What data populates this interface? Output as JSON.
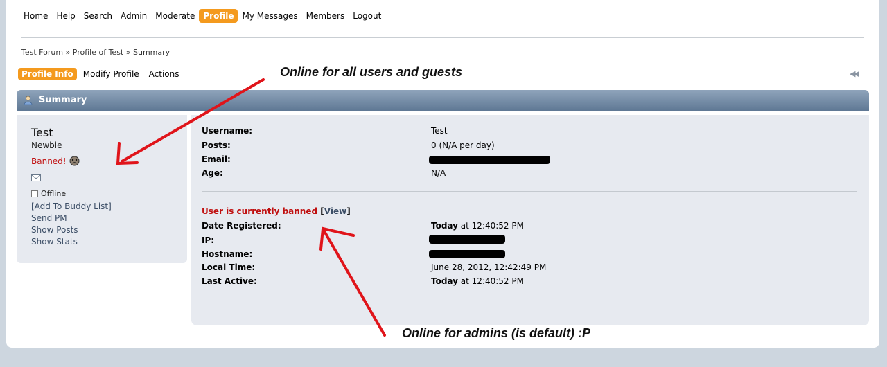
{
  "menu": {
    "items": [
      "Home",
      "Help",
      "Search",
      "Admin",
      "Moderate",
      "Profile",
      "My Messages",
      "Members",
      "Logout"
    ],
    "active": "Profile"
  },
  "breadcrumb": {
    "parts": [
      "Test Forum",
      "Profile of Test",
      "Summary"
    ],
    "separator": "»"
  },
  "subtabs": {
    "items": [
      "Profile Info",
      "Modify Profile",
      "Actions"
    ],
    "active": "Profile Info"
  },
  "summary": {
    "title": "Summary"
  },
  "user": {
    "name": "Test",
    "rank": "Newbie",
    "banned": "Banned!",
    "status": "Offline",
    "links": [
      "[Add To Buddy List]",
      "Send PM",
      "Show Posts",
      "Show Stats"
    ]
  },
  "profile": {
    "username_label": "Username:",
    "username_value": "Test",
    "posts_label": "Posts:",
    "posts_value": "0 (N/A per day)",
    "email_label": "Email:",
    "age_label": "Age:",
    "age_value": "N/A",
    "ban_text": "User is currently banned",
    "ban_view": "View",
    "registered_label": "Date Registered:",
    "registered_bold": "Today",
    "registered_rest": " at 12:40:52 PM",
    "ip_label": "IP:",
    "hostname_label": "Hostname:",
    "localtime_label": "Local Time:",
    "localtime_value": "June 28, 2012, 12:42:49 PM",
    "lastactive_label": "Last Active:",
    "lastactive_bold": "Today",
    "lastactive_rest": " at 12:40:52 PM"
  },
  "annotations": {
    "top": "Online for all users and guests",
    "bottom": "Online for admins (is default) :P"
  },
  "colors": {
    "accent": "#f49a1e",
    "banned_red": "#c01010",
    "arrow_red": "#e0141a"
  },
  "icons": {
    "summary": "user-icon",
    "banned": "sad-face-icon",
    "email": "envelope-icon",
    "rewind": "rewind-icon"
  }
}
